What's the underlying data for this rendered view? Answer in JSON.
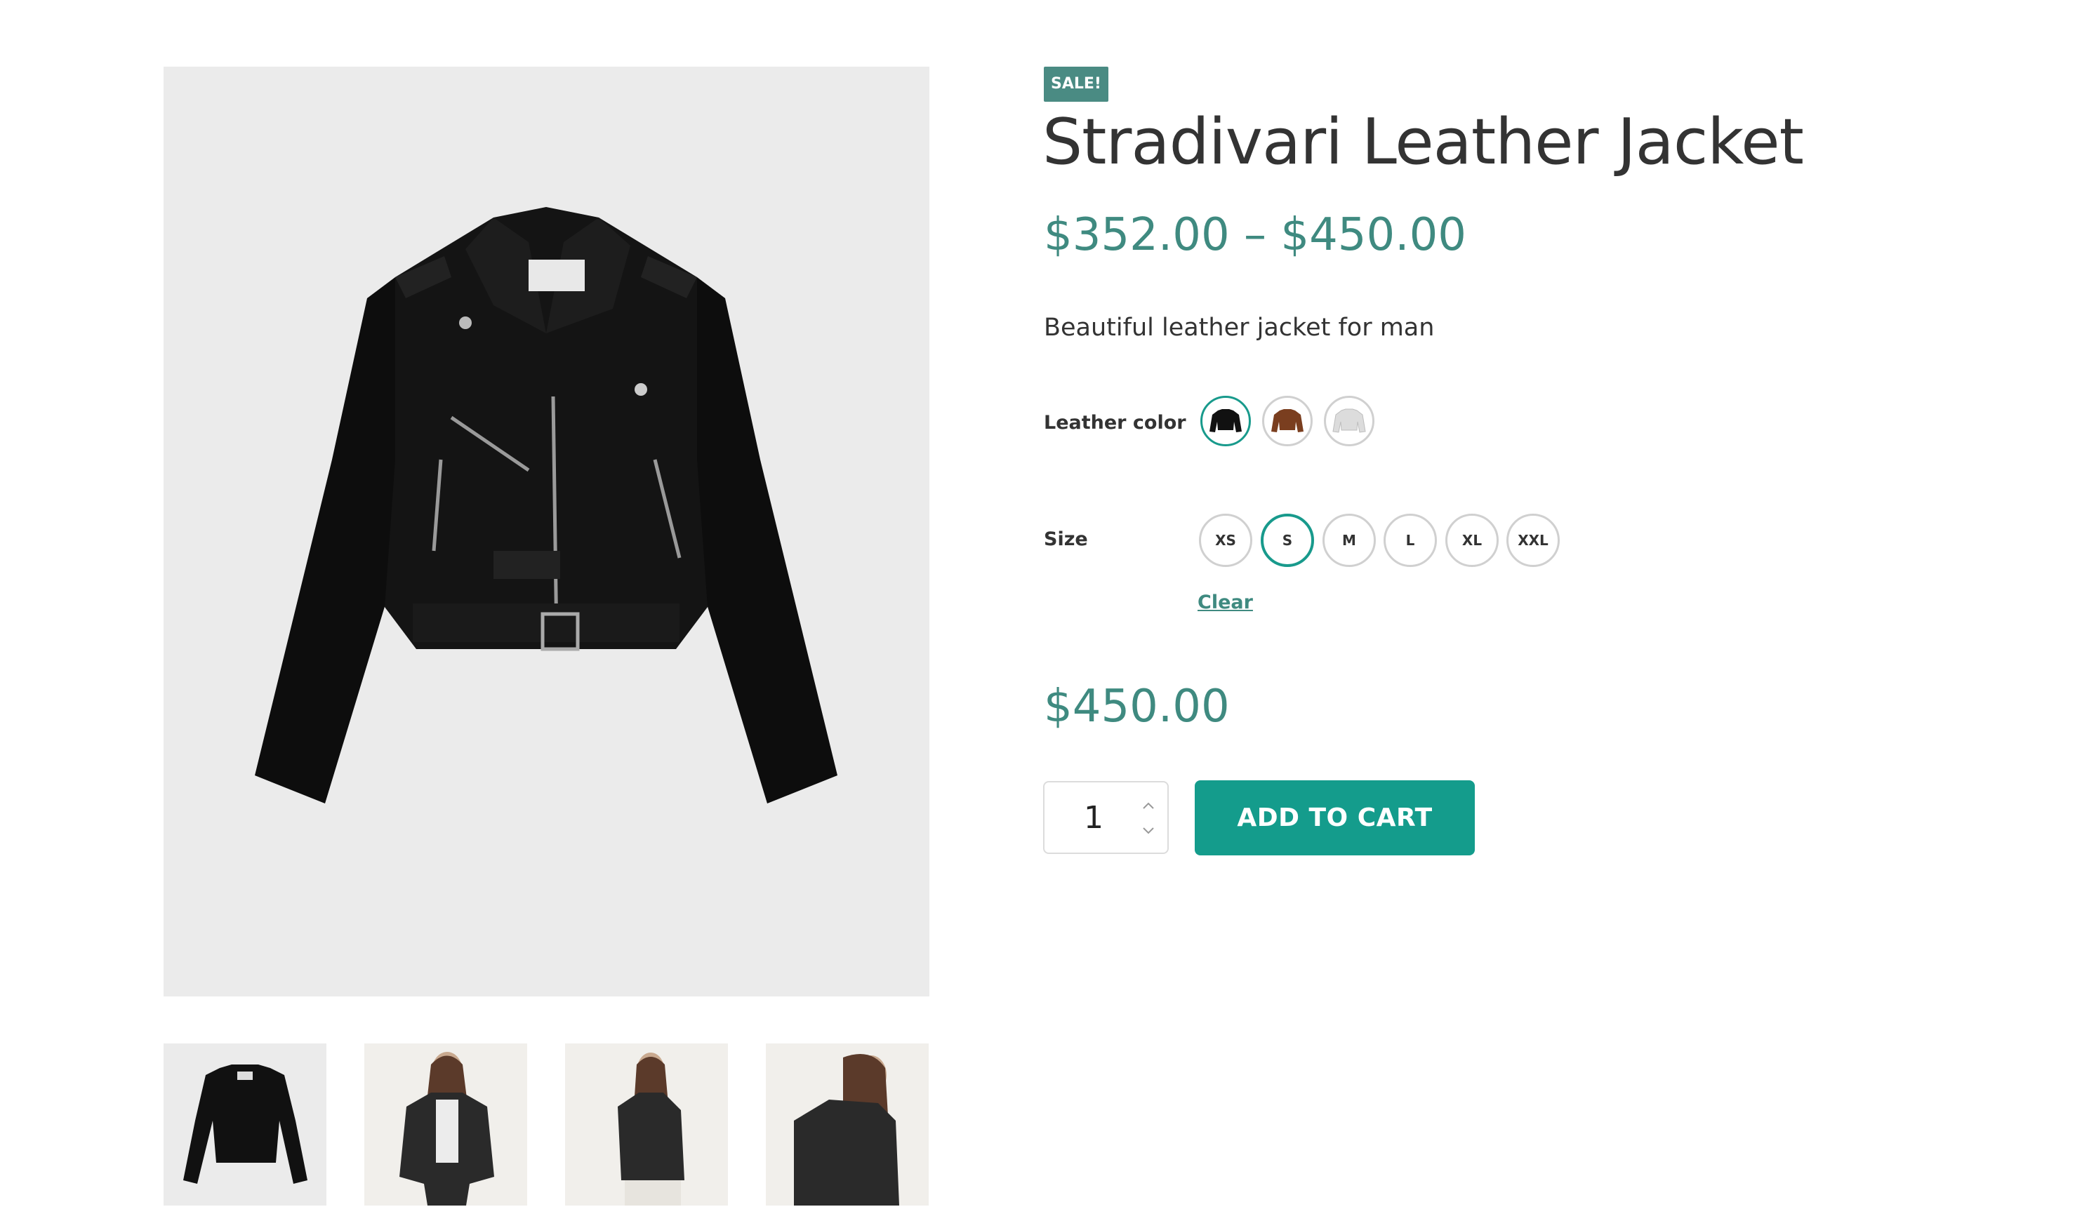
{
  "badge": {
    "label": "SALE!"
  },
  "product": {
    "title": "Stradivari Leather Jacket",
    "price_range": "$352.00 – $450.00",
    "short_description": "Beautiful leather jacket for man",
    "variation_price": "$450.00"
  },
  "attributes": {
    "color": {
      "label": "Leather color",
      "options": [
        {
          "name": "black",
          "color": "#111111",
          "selected": true
        },
        {
          "name": "brown",
          "color": "#7a3e1f",
          "selected": false
        },
        {
          "name": "white",
          "color": "#d9d9d9",
          "selected": false
        }
      ]
    },
    "size": {
      "label": "Size",
      "options": [
        "XS",
        "S",
        "M",
        "L",
        "XL",
        "XXL"
      ],
      "selected": "S"
    },
    "clear_label": "Clear"
  },
  "cart": {
    "quantity": "1",
    "add_to_cart_label": "ADD TO CART"
  },
  "gallery": {
    "thumbnails": [
      "jacket-flat",
      "model-front",
      "model-side",
      "model-turn"
    ]
  },
  "colors": {
    "accent": "#149c8c",
    "price": "#3f8a80",
    "badge": "#4a8b83",
    "image_bg": "#ebebeb"
  }
}
